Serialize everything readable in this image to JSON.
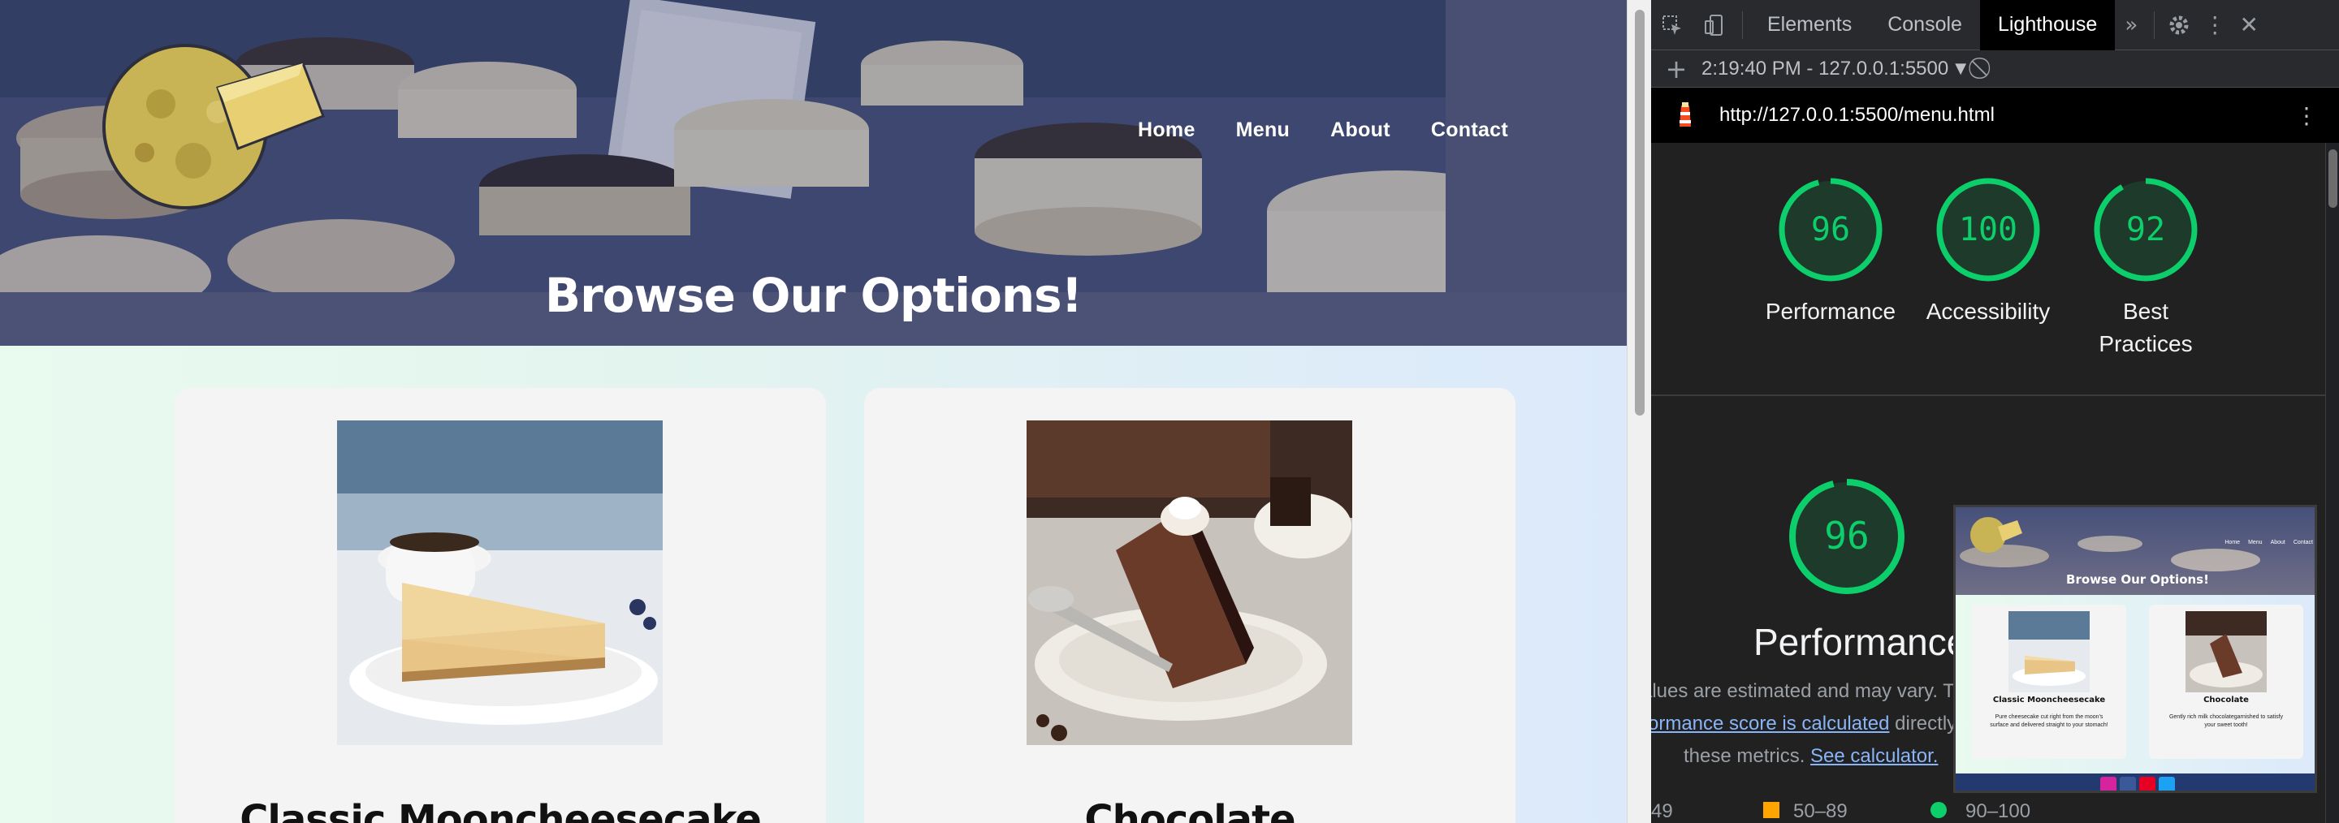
{
  "site": {
    "nav": [
      "Home",
      "Menu",
      "About",
      "Contact"
    ],
    "hero_title": "Browse Our Options!",
    "cards": [
      {
        "title": "Classic Mooncheesecake"
      },
      {
        "title": "Chocolate"
      }
    ]
  },
  "devtools": {
    "tabs": [
      "Elements",
      "Console",
      "Lighthouse"
    ],
    "active_tab": "Lighthouse",
    "report_selector": "2:19:40 PM - 127.0.0.1:5500",
    "url": "http://127.0.0.1:5500/menu.html",
    "scores": [
      {
        "value": "96",
        "label_lines": [
          "Performance"
        ],
        "score": 96
      },
      {
        "value": "100",
        "label_lines": [
          "Accessibility"
        ],
        "score": 100
      },
      {
        "value": "92",
        "label_lines": [
          "Best",
          "Practices"
        ],
        "score": 92
      }
    ],
    "performance": {
      "value": "96",
      "label": "Performance",
      "score": 96
    },
    "description": {
      "line1": "alues are estimated and may vary. T",
      "line2_link": "ormance score is calculated",
      "line2_rest": " directly",
      "line3_pre": "these metrics. ",
      "line3_link": "See calculator."
    },
    "legend": {
      "low": "49",
      "mid": "50–89",
      "high": "90–100"
    },
    "thumbnail": {
      "nav": [
        "Home",
        "Menu",
        "About",
        "Contact"
      ],
      "hero_title": "Browse Our Options!",
      "cards": [
        {
          "title": "Classic Mooncheesecake",
          "text": "Pure cheesecake cut right from the moon's surface and delivered straight to your stomach!"
        },
        {
          "title": "Chocolate",
          "text": "Gently rich milk chocolategarnished to satisfy your sweet tooth!"
        }
      ]
    },
    "colors": {
      "pass": "#0cce6b",
      "average": "#ffa400",
      "gauge_bg": "#1e3a2a"
    }
  }
}
